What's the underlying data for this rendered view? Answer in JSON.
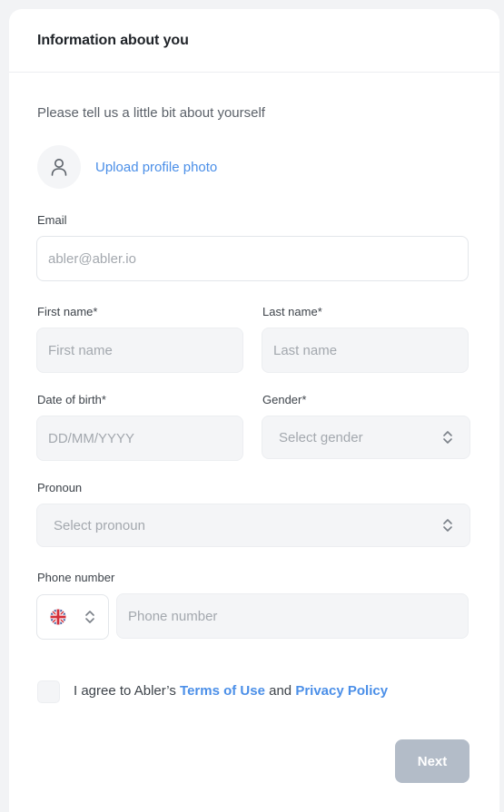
{
  "header": {
    "title": "Information about you"
  },
  "intro": "Please tell us a little bit about yourself",
  "profile": {
    "upload_label": "Upload profile photo",
    "avatar_icon": "user-icon"
  },
  "fields": {
    "email": {
      "label": "Email",
      "placeholder": "abler@abler.io"
    },
    "first_name": {
      "label": "First name*",
      "placeholder": "First name"
    },
    "last_name": {
      "label": "Last name*",
      "placeholder": "Last name"
    },
    "dob": {
      "label": "Date of birth*",
      "placeholder": "DD/MM/YYYY"
    },
    "gender": {
      "label": "Gender*",
      "selected": "Select gender"
    },
    "pronoun": {
      "label": "Pronoun",
      "selected": "Select pronoun"
    },
    "phone": {
      "label": "Phone number",
      "placeholder": "Phone number",
      "country_icon": "uk-flag-icon"
    }
  },
  "agreement": {
    "prefix": "I agree to Abler’s",
    "terms": "Terms of Use",
    "and": "and",
    "privacy": "Privacy Policy",
    "checked": false
  },
  "actions": {
    "next_label": "Next"
  },
  "colors": {
    "accent": "#4b8fe8",
    "button_disabled": "#b3bcc8",
    "field_bg": "#f4f5f7"
  }
}
